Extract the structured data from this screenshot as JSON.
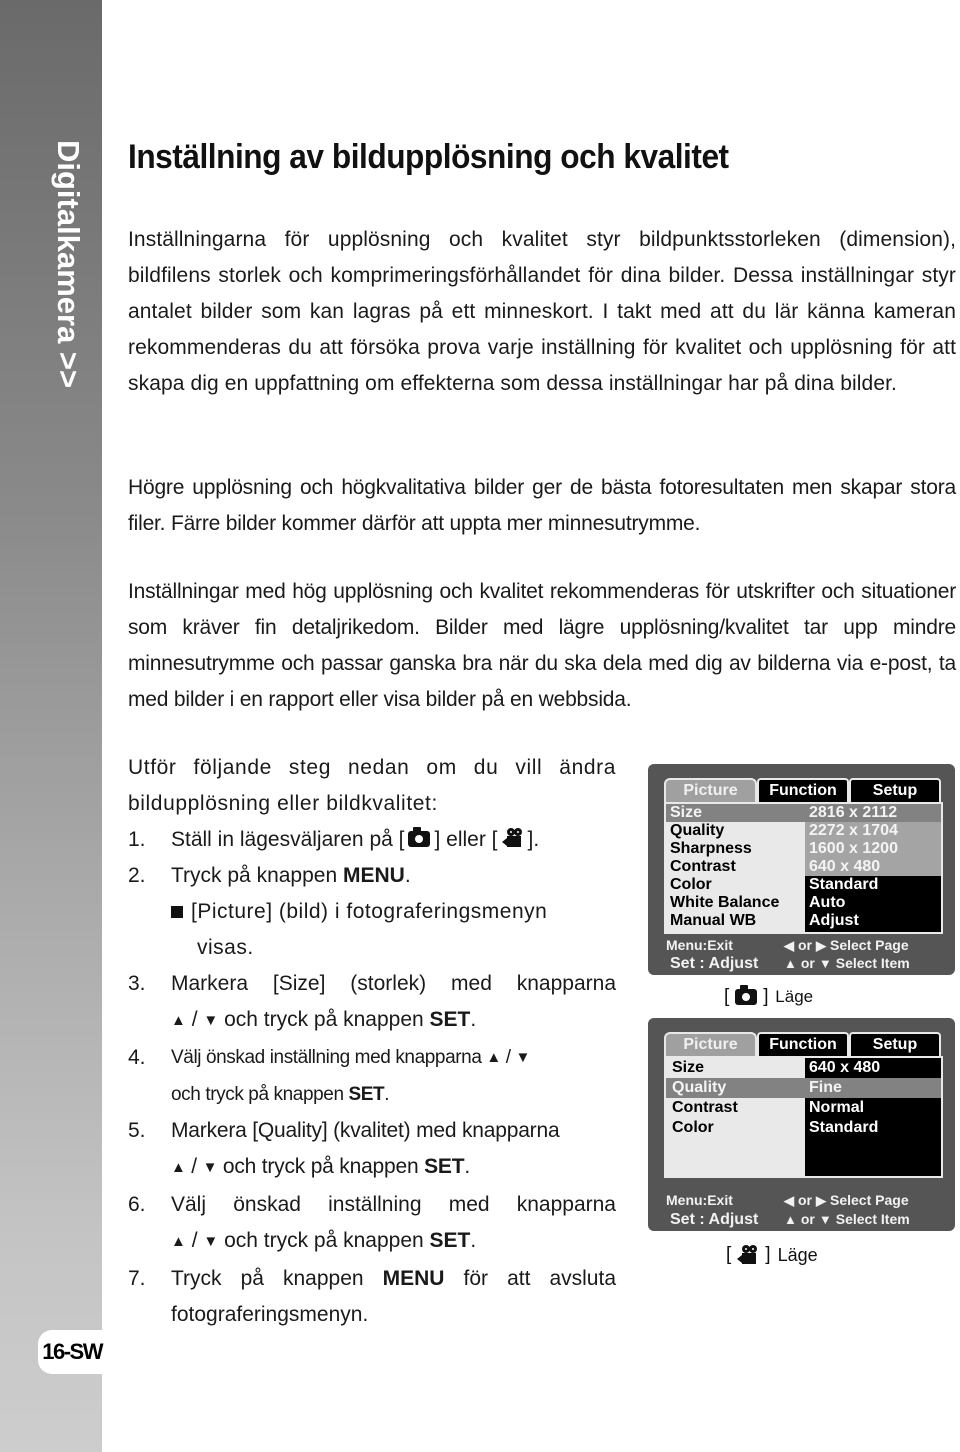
{
  "sidebar": {
    "section_title": "Digitalkamera >>",
    "page_number": "16-SW"
  },
  "page": {
    "title": "Inställning av bildupplösning och kvalitet",
    "paragraphs": [
      "Inställningarna för upplösning och kvalitet styr bildpunktsstorleken (dimension), bildfilens storlek och komprimeringsförhållandet för dina bilder. Dessa inställningar styr antalet bilder som kan lagras på ett minneskort. I takt med att du lär känna kameran rekommenderas du att försöka prova varje inställning för kvalitet och upplösning för att skapa dig en uppfattning om effekterna som dessa inställningar har på dina bilder.",
      "Högre upplösning och högkvalitativa bilder ger de bästa fotoresultaten men skapar stora filer. Färre bilder kommer därför att uppta mer minnesutrymme.",
      "Inställningar med hög upplösning och kvalitet rekommenderas för utskrifter och situationer som kräver fin detaljrikedom. Bilder med lägre upplösning/kvalitet tar upp mindre minnesutrymme och passar ganska bra när du ska dela med dig av bilderna via e-post, ta med bilder i en rapport eller visa bilder på en webbsida."
    ]
  },
  "steps": {
    "intro": "Utför följande steg nedan om du vill ändra bildupplösning eller bildkvalitet:",
    "items": [
      {
        "num": "1.",
        "pre": "Ställ in lägesväljaren på [",
        "mid": "] eller [",
        "post": "]."
      },
      {
        "num": "2.",
        "pre": "Tryck på knappen ",
        "kw": "MENU",
        "post": "."
      },
      {
        "bullet": "[Picture] (bild) i fotograferingsmenyn",
        "bullet_cont": "visas."
      },
      {
        "num": "3.",
        "line1": "Markera [Size] (storlek) med knapparna",
        "pre": " / ",
        "post_a": " och tryck på knappen ",
        "kw": "SET",
        "post": "."
      },
      {
        "num": "4.",
        "line1": "Välj önskad inställning med knapparna",
        "sep": " / ",
        "line2": "och tryck på knappen ",
        "kw": "SET",
        "post": "."
      },
      {
        "num": "5.",
        "line1": "Markera [Quality] (kvalitet) med knapparna",
        "sep": " / ",
        "post_a": " och tryck på knappen ",
        "kw": "SET",
        "post": "."
      },
      {
        "num": "6.",
        "line1": "Välj önskad inställning med knapparna",
        "sep": " / ",
        "post_a": " och tryck på knappen ",
        "kw": "SET",
        "post": "."
      },
      {
        "num": "7.",
        "pre": "Tryck på knappen ",
        "kw": "MENU",
        "post_a": " för att avsluta",
        "line2": "fotograferingsmenyn."
      }
    ],
    "up_arrow": "▲",
    "down_arrow": "▼"
  },
  "screens": [
    {
      "tabs": [
        "Picture",
        "Function",
        "Setup"
      ],
      "active_tab": "Picture",
      "items": [
        "Size",
        "Quality",
        "Sharpness",
        "Contrast",
        "Color",
        "White Balance",
        "Manual WB"
      ],
      "highlighted_item": "Size",
      "values": [
        "2816 x 2112",
        "2272 x 1704",
        "1600 x 1200",
        "640 x 480",
        "Standard",
        "Auto",
        "Adjust"
      ],
      "hint_exit": "Menu:Exit",
      "hint_adjust": "Set : Adjust",
      "hint_page": "Select Page",
      "hint_item": "Select Item",
      "or": "or",
      "mode_label": "Läge",
      "mode_icon": "camera-icon"
    },
    {
      "tabs": [
        "Picture",
        "Function",
        "Setup"
      ],
      "active_tab": "Picture",
      "items": [
        "Size",
        "Quality",
        "Contrast",
        "Color"
      ],
      "highlighted_item": "Quality",
      "values": [
        "640 x 480",
        "Fine",
        "Normal",
        "Standard"
      ],
      "hint_exit": "Menu:Exit",
      "hint_adjust": "Set : Adjust",
      "hint_page": "Select Page",
      "hint_item": "Select Item",
      "or": "or",
      "mode_label": "Läge",
      "mode_icon": "video-camera-icon"
    }
  ],
  "colors": {
    "sidebar_top": "#6a6a6a",
    "sidebar_bottom": "#cdcdcd",
    "screen_frame": "#555555",
    "highlight_row": "#828282",
    "panel_bg": "#e9e9e9"
  }
}
